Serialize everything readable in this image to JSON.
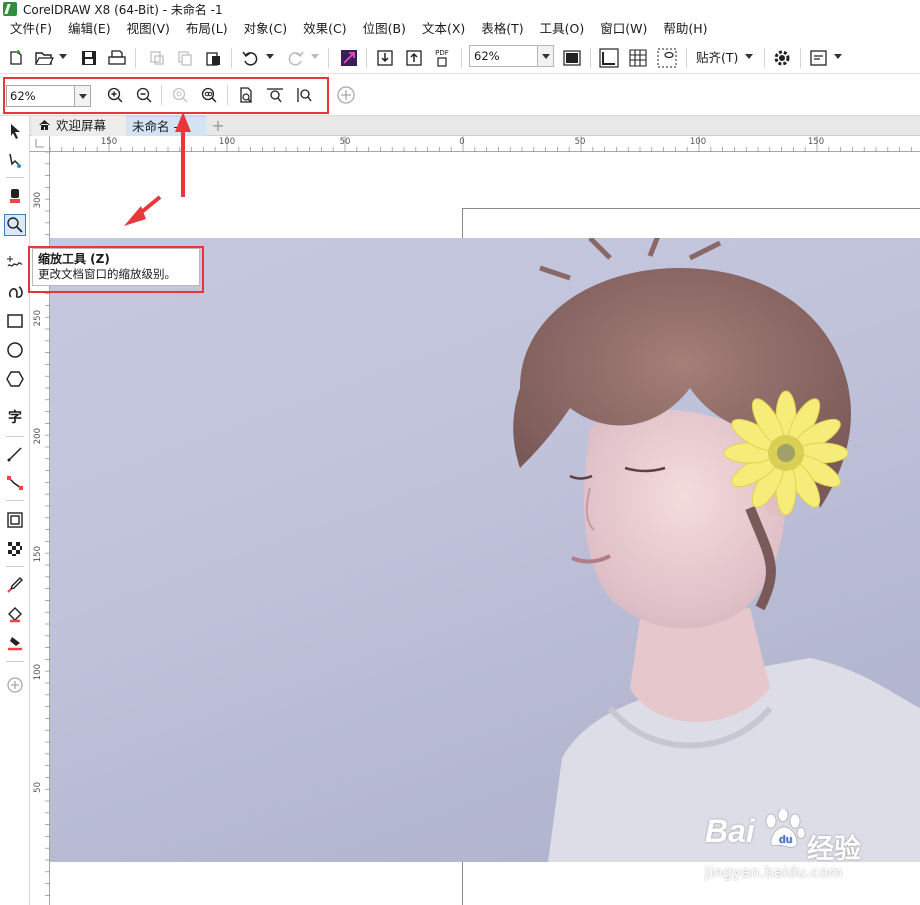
{
  "window": {
    "title": "CorelDRAW X8 (64-Bit) - 未命名 -1"
  },
  "menu": [
    {
      "label": "文件(F)"
    },
    {
      "label": "编辑(E)"
    },
    {
      "label": "视图(V)"
    },
    {
      "label": "布局(L)"
    },
    {
      "label": "对象(C)"
    },
    {
      "label": "效果(C)"
    },
    {
      "label": "位图(B)"
    },
    {
      "label": "文本(X)"
    },
    {
      "label": "表格(T)"
    },
    {
      "label": "工具(O)"
    },
    {
      "label": "窗口(W)"
    },
    {
      "label": "帮助(H)"
    }
  ],
  "toolbar": {
    "zoom_level": "62%",
    "pdf_label": "PDF",
    "snap_label": "贴齐(T)"
  },
  "property_bar": {
    "zoom_level": "62%"
  },
  "tabs": [
    {
      "label": "欢迎屏幕"
    },
    {
      "label": "未命名 -1"
    }
  ],
  "tab_add": "+",
  "ruler_h": [
    "150",
    "100",
    "50",
    "0",
    "50",
    "100",
    "150"
  ],
  "ruler_v": [
    "300",
    "250",
    "200",
    "150",
    "100",
    "50"
  ],
  "tooltip": {
    "title": "缩放工具 (Z)",
    "description": "更改文档窗口的缩放级别。"
  },
  "toolbox": {
    "text_tool_glyph": "字"
  },
  "watermark": {
    "brand": "Bai",
    "chinese": "经验",
    "url": "jingyan.baidu.com"
  },
  "colors": {
    "highlight_red": "#e8363a",
    "photo_bg": "#c2c5dc",
    "accent_blue": "#3c7fc6"
  }
}
